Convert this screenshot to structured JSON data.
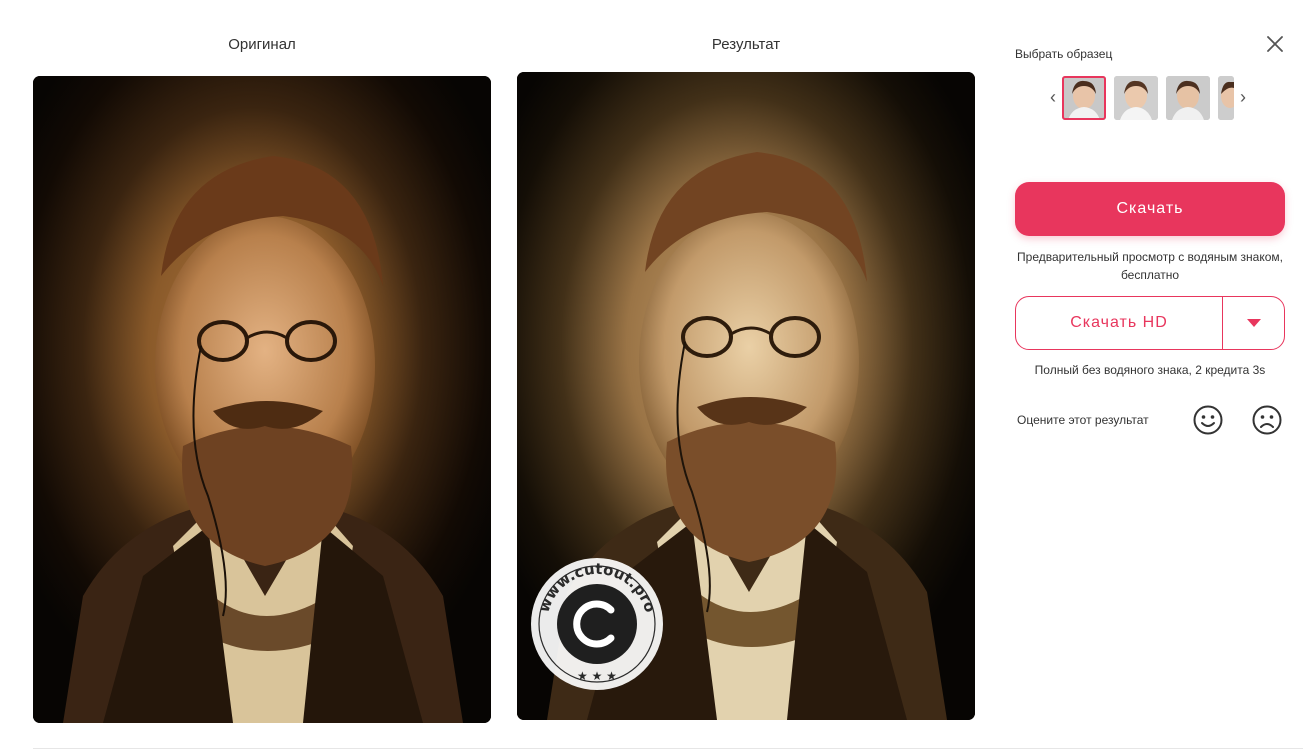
{
  "columns": {
    "original_title": "Оригинал",
    "result_title": "Результат"
  },
  "result_watermark": "www.cutout.pro",
  "sidebar": {
    "sample_label": "Выбрать образец",
    "thumb_count": 4,
    "selected_thumb": 0,
    "download_label": "Скачать",
    "preview_note": "Предварительный просмотр с водяным знаком, бесплатно",
    "download_hd_label": "Скачать HD",
    "hd_note": "Полный без водяного знака, 2 кредита 3s",
    "rate_label": "Оцените этот результат"
  },
  "icons": {
    "close": "close-icon",
    "prev": "chevron-left-icon",
    "next": "chevron-right-icon",
    "dropdown": "caret-down-icon",
    "good": "smile-icon",
    "bad": "frown-icon"
  },
  "colors": {
    "accent": "#e8365d",
    "text": "#333333",
    "photo_bg": "#0b0806",
    "sepia": "#a0642e"
  }
}
